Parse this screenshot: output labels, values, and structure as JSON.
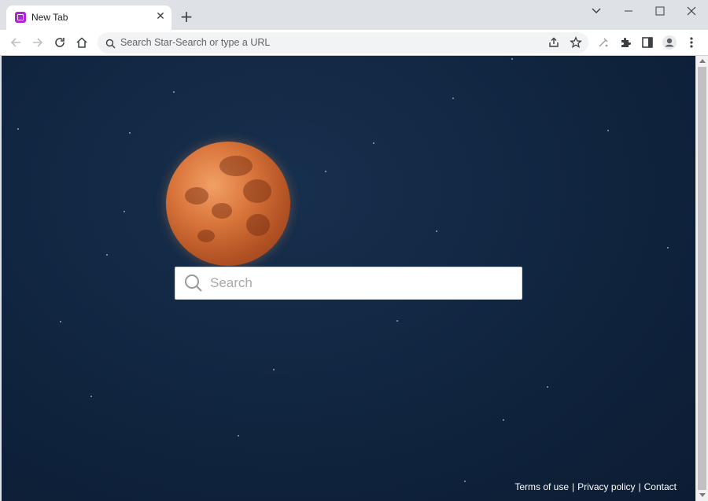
{
  "tab": {
    "title": "New Tab",
    "favicon_color": "#b123d8"
  },
  "address_bar": {
    "text": "Search Star-Search or type a URL"
  },
  "search": {
    "placeholder": "Search"
  },
  "footer": {
    "terms": "Terms of use",
    "privacy": "Privacy policy",
    "contact": "Contact",
    "separator": "|"
  },
  "colors": {
    "background": "#112641",
    "moon": "#d9763c"
  },
  "icons": {
    "toolbar": [
      "back-icon",
      "forward-icon",
      "reload-icon",
      "home-icon",
      "share-icon",
      "star-icon",
      "extension-puzzle-icon",
      "side-panel-icon",
      "profile-icon",
      "menu-icon"
    ],
    "window": [
      "tab-search-icon",
      "minimize-icon",
      "maximize-icon",
      "close-icon"
    ]
  }
}
